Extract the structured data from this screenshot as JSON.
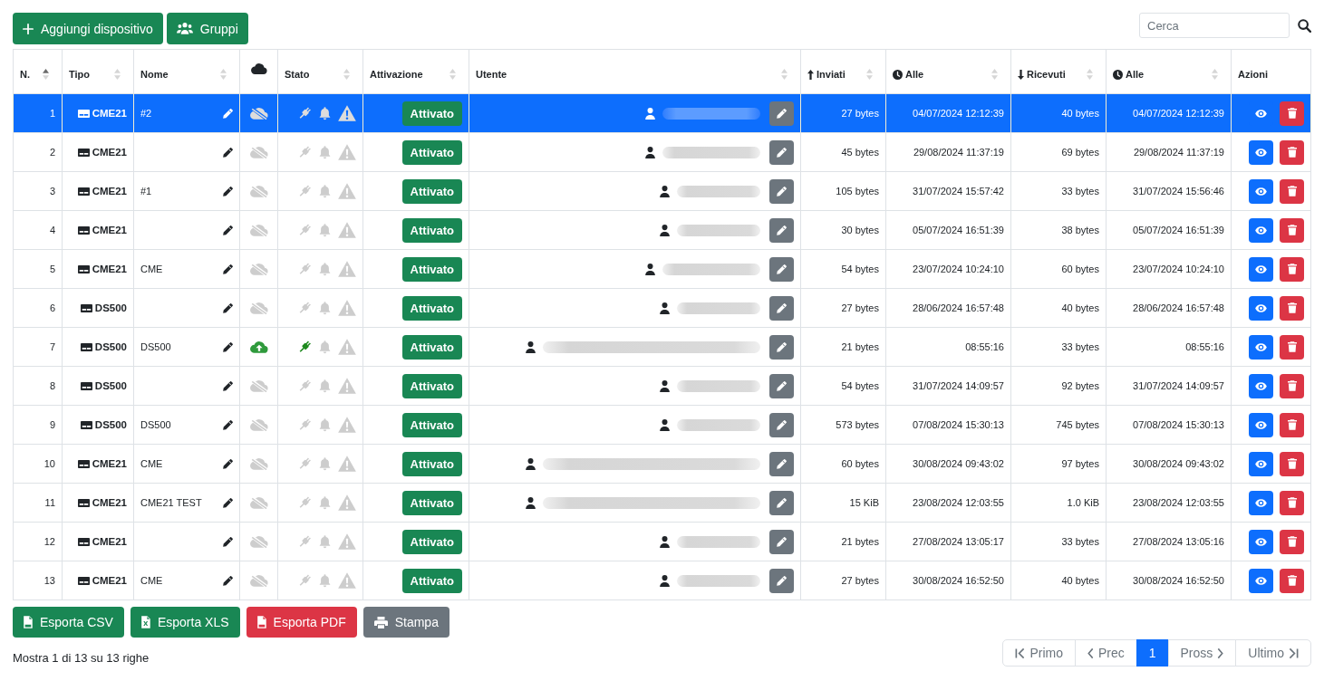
{
  "toolbar": {
    "buttons": [
      {
        "label": "Aggiungi dispositivo",
        "kind": "add"
      },
      {
        "label": "Gruppi",
        "kind": "groups"
      }
    ],
    "search": {
      "placeholder": "Cerca"
    }
  },
  "table": {
    "columns": [
      {
        "label": "N.",
        "kind": "plain",
        "sorted": true
      },
      {
        "label": "Tipo",
        "kind": "plain",
        "sorted": false
      },
      {
        "label": "Nome",
        "kind": "plain",
        "sorted": false
      },
      {
        "kind": "cloud"
      },
      {
        "label": "Stato",
        "kind": "plain",
        "sorted": false
      },
      {
        "label": "Attivazione",
        "kind": "plain",
        "sorted": false
      },
      {
        "label": "Utente",
        "kind": "plain",
        "sorted": false
      },
      {
        "label": "Inviati",
        "kind": "up",
        "sorted": false
      },
      {
        "label": "Alle",
        "kind": "clock",
        "sorted": false
      },
      {
        "label": "Ricevuti",
        "kind": "down",
        "sorted": false
      },
      {
        "label": "Alle",
        "kind": "clock",
        "sorted": false
      },
      {
        "label": "Azioni",
        "kind": "plain"
      }
    ],
    "rows": [
      {
        "selected": true,
        "number": "1",
        "type": "CME21",
        "name": "#2",
        "connected": false,
        "powered": false,
        "alarm": false,
        "warning": false,
        "activation": "Attivato",
        "user": {
          "kind": "medium"
        },
        "sent": "27 bytes",
        "sent_at": "04/07/2024 12:12:39",
        "received": "40 bytes",
        "received_at": "04/07/2024 12:12:39"
      },
      {
        "selected": false,
        "number": "2",
        "type": "CME21",
        "connected": false,
        "powered": false,
        "alarm": false,
        "warning": false,
        "activation": "Attivato",
        "user": {
          "kind": "medium"
        },
        "sent": "45 bytes",
        "sent_at": "29/08/2024 11:37:19",
        "received": "69 bytes",
        "received_at": "29/08/2024 11:37:19"
      },
      {
        "selected": false,
        "number": "3",
        "type": "CME21",
        "name": "#1",
        "connected": false,
        "powered": false,
        "alarm": false,
        "warning": false,
        "activation": "Attivato",
        "user": {
          "kind": "short"
        },
        "sent": "105 bytes",
        "sent_at": "31/07/2024 15:57:42",
        "received": "33 bytes",
        "received_at": "31/07/2024 15:56:46"
      },
      {
        "selected": false,
        "number": "4",
        "type": "CME21",
        "connected": false,
        "powered": false,
        "alarm": false,
        "warning": false,
        "activation": "Attivato",
        "user": {
          "kind": "short"
        },
        "sent": "30 bytes",
        "sent_at": "05/07/2024 16:51:39",
        "received": "38 bytes",
        "received_at": "05/07/2024 16:51:39"
      },
      {
        "selected": false,
        "number": "5",
        "type": "CME21",
        "name": "CME",
        "connected": false,
        "powered": false,
        "alarm": false,
        "warning": false,
        "activation": "Attivato",
        "user": {
          "kind": "medium"
        },
        "sent": "54 bytes",
        "sent_at": "23/07/2024 10:24:10",
        "received": "60 bytes",
        "received_at": "23/07/2024 10:24:10"
      },
      {
        "selected": false,
        "number": "6",
        "type": "DS500",
        "connected": false,
        "powered": false,
        "alarm": false,
        "warning": false,
        "activation": "Attivato",
        "user": {
          "kind": "short"
        },
        "sent": "27 bytes",
        "sent_at": "28/06/2024 16:57:48",
        "received": "40 bytes",
        "received_at": "28/06/2024 16:57:48"
      },
      {
        "selected": false,
        "number": "7",
        "type": "DS500",
        "name": "DS500",
        "connected": true,
        "powered": true,
        "alarm": false,
        "warning": false,
        "activation": "Attivato",
        "user": {
          "kind": "long"
        },
        "sent": "21 bytes",
        "sent_at": "08:55:16",
        "received": "33 bytes",
        "received_at": "08:55:16"
      },
      {
        "selected": false,
        "number": "8",
        "type": "DS500",
        "connected": false,
        "powered": false,
        "alarm": false,
        "warning": false,
        "activation": "Attivato",
        "user": {
          "kind": "short"
        },
        "sent": "54 bytes",
        "sent_at": "31/07/2024 14:09:57",
        "received": "92 bytes",
        "received_at": "31/07/2024 14:09:57"
      },
      {
        "selected": false,
        "number": "9",
        "type": "DS500",
        "name": "DS500",
        "connected": false,
        "powered": false,
        "alarm": false,
        "warning": false,
        "activation": "Attivato",
        "user": {
          "kind": "short"
        },
        "sent": "573 bytes",
        "sent_at": "07/08/2024 15:30:13",
        "received": "745 bytes",
        "received_at": "07/08/2024 15:30:13"
      },
      {
        "selected": false,
        "number": "10",
        "type": "CME21",
        "name": "CME",
        "connected": false,
        "powered": false,
        "alarm": false,
        "warning": false,
        "activation": "Attivato",
        "user": {
          "kind": "long"
        },
        "sent": "60 bytes",
        "sent_at": "30/08/2024 09:43:02",
        "received": "97 bytes",
        "received_at": "30/08/2024 09:43:02"
      },
      {
        "selected": false,
        "number": "11",
        "type": "CME21",
        "name": "CME21 TEST",
        "connected": false,
        "powered": false,
        "alarm": false,
        "warning": false,
        "activation": "Attivato",
        "user": {
          "kind": "long"
        },
        "sent": "15 KiB",
        "sent_at": "23/08/2024 12:03:55",
        "received": "1.0 KiB",
        "received_at": "23/08/2024 12:03:55"
      },
      {
        "selected": false,
        "number": "12",
        "type": "CME21",
        "connected": false,
        "powered": false,
        "alarm": false,
        "warning": false,
        "activation": "Attivato",
        "user": {
          "kind": "short"
        },
        "sent": "21 bytes",
        "sent_at": "27/08/2024 13:05:17",
        "received": "33 bytes",
        "received_at": "27/08/2024 13:05:16"
      },
      {
        "selected": false,
        "number": "13",
        "type": "CME21",
        "name": "CME",
        "connected": false,
        "powered": false,
        "alarm": false,
        "warning": false,
        "activation": "Attivato",
        "user": {
          "kind": "short"
        },
        "sent": "27 bytes",
        "sent_at": "30/08/2024 16:52:50",
        "received": "40 bytes",
        "received_at": "30/08/2024 16:52:50"
      }
    ]
  },
  "export_buttons": [
    {
      "label": "Esporta CSV",
      "kind": "csv"
    },
    {
      "label": "Esporta XLS",
      "kind": "xls"
    },
    {
      "label": "Esporta PDF",
      "kind": "pdf"
    },
    {
      "label": "Stampa",
      "kind": "print"
    }
  ],
  "footer": {
    "info": "Mostra 1 di 13 su 13 righe"
  },
  "pagination": [
    {
      "label": "Primo",
      "kind": "first",
      "selected": false,
      "disabled": true
    },
    {
      "label": "Prec",
      "kind": "prev",
      "selected": false,
      "disabled": true
    },
    {
      "label": "1",
      "kind": "page",
      "selected": true,
      "disabled": false
    },
    {
      "label": "Pross",
      "kind": "next",
      "selected": false,
      "disabled": true
    },
    {
      "label": "Ultimo",
      "kind": "last",
      "selected": false,
      "disabled": true
    }
  ]
}
